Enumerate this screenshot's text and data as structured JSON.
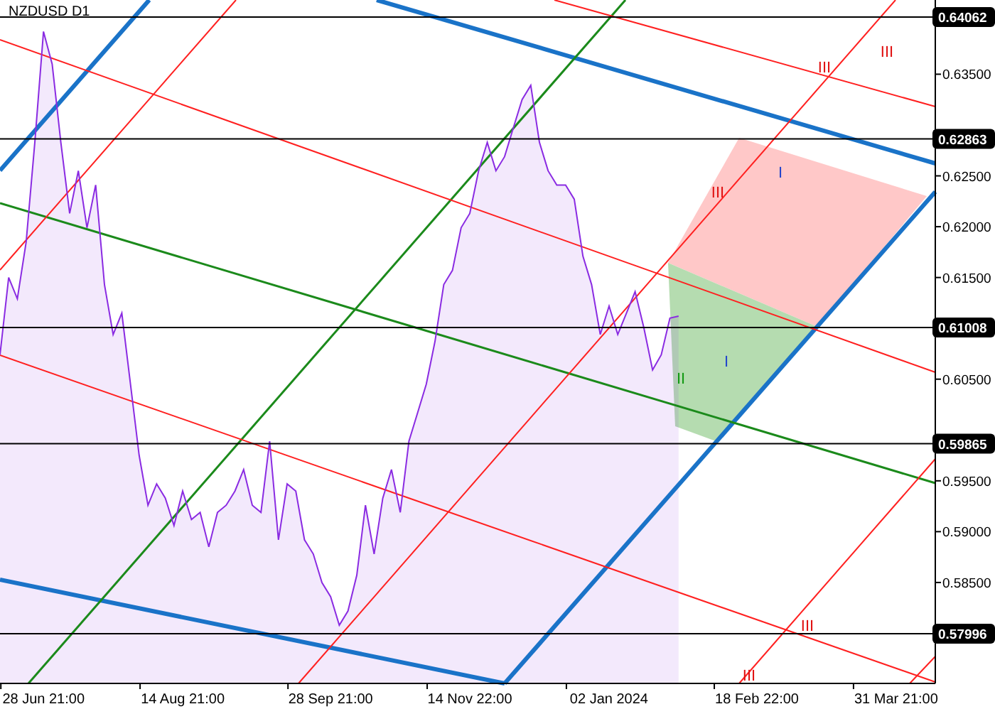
{
  "chart": {
    "chart_data": {
      "type": "area",
      "title": "NZDUSD D1",
      "categories": [
        null,
        null,
        null,
        null,
        null,
        "28 Jun 21:00",
        null,
        null,
        null,
        null,
        null,
        null,
        null,
        null,
        null,
        null,
        null,
        null,
        null,
        null,
        null,
        "14 Aug 21:00",
        null,
        null,
        null,
        null,
        null,
        null,
        null,
        null,
        null,
        null,
        null,
        null,
        null,
        null,
        null,
        null,
        "28 Sep 21:00",
        null,
        null,
        null,
        null,
        null,
        null,
        null,
        null,
        null,
        null,
        null,
        null,
        null,
        null,
        null,
        "14 Nov 22:00",
        null,
        null,
        null,
        null,
        null,
        null,
        null,
        null,
        null,
        null,
        null,
        null,
        null,
        null,
        null,
        "02 Jan 2024",
        null,
        null,
        null,
        null,
        null,
        null,
        null,
        null,
        null,
        null,
        null,
        null,
        null,
        null,
        null,
        null,
        "18 Feb 22:00",
        null,
        null,
        null,
        null,
        null,
        null,
        null,
        null,
        null,
        null,
        null,
        null,
        null,
        null,
        null,
        "31 Mar 21:00",
        null,
        null,
        null,
        null
      ],
      "series": [
        {
          "color": "#8a2be2",
          "values": [
            0.6074,
            0.615,
            0.6129,
            0.6185,
            0.6283,
            0.6392,
            0.636,
            0.6283,
            0.6213,
            0.6255,
            0.6199,
            0.6241,
            0.6143,
            0.6094,
            0.6115,
            0.6045,
            0.5975,
            0.5926,
            0.5947,
            0.5933,
            0.5906,
            0.594,
            0.5912,
            0.5919,
            0.5885,
            0.5919,
            0.5926,
            0.594,
            0.5961,
            0.5926,
            0.5919,
            0.5989,
            0.5892,
            0.5947,
            0.594,
            0.5892,
            0.5878,
            0.585,
            0.5836,
            0.5808,
            0.5822,
            0.5857,
            0.5926,
            0.5878,
            0.5933,
            0.5961,
            0.5919,
            0.5989,
            0.6017,
            0.6045,
            0.6087,
            0.6143,
            0.6157,
            0.6199,
            0.6213,
            0.6255,
            0.6283,
            0.6255,
            0.6269,
            0.6297,
            0.6325,
            0.6339,
            0.6283,
            0.6255,
            0.6241,
            0.6241,
            0.6227,
            0.6171,
            0.6143,
            0.6094,
            0.6122,
            0.6094,
            0.6115,
            0.6136,
            0.6101,
            0.6059,
            0.6074,
            0.611,
            0.6112,
            null,
            null,
            null,
            null,
            null,
            null,
            null,
            null,
            null,
            null,
            null,
            null,
            null,
            null,
            null,
            null,
            null,
            null,
            null,
            null,
            null,
            null,
            null,
            null,
            null,
            null,
            null,
            null,
            null
          ]
        }
      ],
      "ylim": [
        0.57507,
        0.6423
      ],
      "yticks": [
        {
          "value": 0.635,
          "label": "0.63500"
        },
        {
          "value": 0.625,
          "label": "0.62500"
        },
        {
          "value": 0.62,
          "label": "0.62000"
        },
        {
          "value": 0.615,
          "label": "0.61500"
        },
        {
          "value": 0.605,
          "label": "0.60500"
        },
        {
          "value": 0.595,
          "label": "0.59500"
        },
        {
          "value": 0.59,
          "label": "0.59000"
        },
        {
          "value": 0.585,
          "label": "0.58500"
        }
      ],
      "ref_lines": [
        {
          "axis": "y",
          "value": 0.64062,
          "label": "0.64062"
        },
        {
          "axis": "y",
          "value": 0.62863,
          "label": "0.62863"
        },
        {
          "axis": "y",
          "value": 0.61008,
          "label": "0.61008"
        },
        {
          "axis": "y",
          "value": 0.59865,
          "label": "0.59865"
        },
        {
          "axis": "y",
          "value": 0.57996,
          "label": "0.57996"
        }
      ]
    },
    "wave_labels": [
      {
        "text": "III",
        "color": "#e01010"
      },
      {
        "text": "III",
        "color": "#e01010"
      },
      {
        "text": "III",
        "color": "#e01010"
      },
      {
        "text": "I",
        "color": "#2244cc"
      },
      {
        "text": "I",
        "color": "#2244cc"
      },
      {
        "text": "II",
        "color": "#119911"
      },
      {
        "text": "III",
        "color": "#e01010"
      },
      {
        "text": "III",
        "color": "#e01010"
      }
    ]
  }
}
